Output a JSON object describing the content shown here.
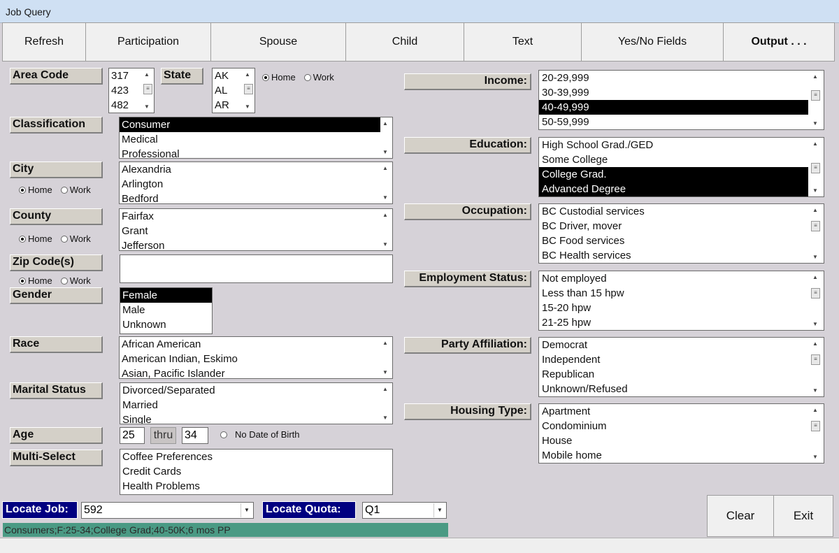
{
  "window": {
    "title": "Job Query"
  },
  "toolbar": {
    "refresh": "Refresh",
    "participation": "Participation",
    "spouse": "Spouse",
    "child": "Child",
    "text": "Text",
    "yes_no": "Yes/No Fields",
    "output": "Output . . ."
  },
  "radio": {
    "home": "Home",
    "work": "Work"
  },
  "area_code": {
    "label": "Area Code",
    "items": [
      "317",
      "423",
      "482"
    ]
  },
  "state": {
    "label": "State",
    "items": [
      "AK",
      "AL",
      "AR"
    ],
    "selected_radio": "Home"
  },
  "classification": {
    "label": "Classification",
    "items": [
      "Consumer",
      "Medical",
      "Professional"
    ],
    "selected": [
      "Consumer"
    ]
  },
  "city": {
    "label": "City",
    "items": [
      "Alexandria",
      "Arlington",
      "Bedford"
    ],
    "selected_radio": "Home"
  },
  "county": {
    "label": "County",
    "items": [
      "Fairfax",
      "Grant",
      "Jefferson"
    ],
    "selected_radio": "Home"
  },
  "zip": {
    "label": "Zip Code(s)",
    "value": "",
    "selected_radio": "Home"
  },
  "gender": {
    "label": "Gender",
    "items": [
      "Female",
      "Male",
      "Unknown"
    ],
    "selected": [
      "Female"
    ]
  },
  "race": {
    "label": "Race",
    "items": [
      "African American",
      "American Indian, Eskimo",
      "Asian, Pacific Islander"
    ]
  },
  "marital": {
    "label": "Marital Status",
    "items": [
      "Divorced/Separated",
      "Married",
      "Single"
    ]
  },
  "age": {
    "label": "Age",
    "from": "25",
    "thru_label": "thru",
    "to": "34",
    "no_dob": "No Date of Birth"
  },
  "multi_select": {
    "label": "Multi-Select",
    "items": [
      "Coffee Preferences",
      "Credit Cards",
      "Health Problems"
    ]
  },
  "income": {
    "label": "Income:",
    "items": [
      "20-29,999",
      "30-39,999",
      "40-49,999",
      "50-59,999"
    ],
    "selected": [
      "40-49,999"
    ]
  },
  "education": {
    "label": "Education:",
    "items": [
      "High School Grad./GED",
      "Some College",
      "College Grad.",
      "Advanced Degree"
    ],
    "selected": [
      "College Grad.",
      "Advanced Degree"
    ]
  },
  "occupation": {
    "label": "Occupation:",
    "items": [
      "BC Custodial services",
      "BC Driver, mover",
      "BC Food services",
      "BC Health services"
    ]
  },
  "employment": {
    "label": "Employment Status:",
    "items": [
      "Not employed",
      "Less than 15 hpw",
      "15-20 hpw",
      "21-25 hpw"
    ]
  },
  "party": {
    "label": "Party Affiliation:",
    "items": [
      "Democrat",
      "Independent",
      "Republican",
      "Unknown/Refused"
    ]
  },
  "housing": {
    "label": "Housing Type:",
    "items": [
      "Apartment",
      "Condominium",
      "House",
      "Mobile home"
    ]
  },
  "locate": {
    "job_label": "Locate Job:",
    "job_value": "592",
    "quota_label": "Locate Quota:",
    "quota_value": "Q1"
  },
  "status_text": "Consumers;F:25-34;College Grad;40-50K;6 mos PP",
  "buttons": {
    "clear": "Clear",
    "exit": "Exit"
  }
}
